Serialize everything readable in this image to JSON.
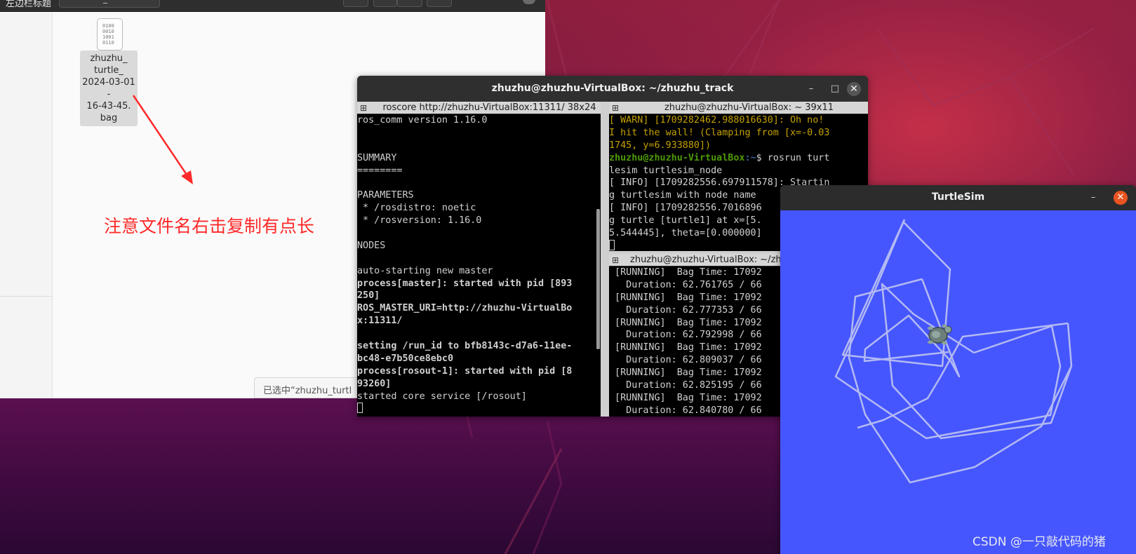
{
  "file_manager": {
    "title": "左边栏标题",
    "path_text": "_",
    "file": {
      "icon": "binary-file-icon",
      "icon_text": "0100\n0010\n1001\n0110",
      "name": "zhuzhu_\nturtle_\n2024-03-01-\n16-43-45.\nbag"
    },
    "annotation": "注意文件名右击复制有点长",
    "status_text": "已选中“zhuzhu_turtl"
  },
  "terminal": {
    "title": "zhuzhu@zhuzhu-VirtualBox: ~/zhuzhu_track",
    "minimize": "–",
    "maximize": "□",
    "close": "✕",
    "pane_icon": "⊞",
    "left_pane": {
      "header": "roscore http://zhuzhu-VirtualBox:11311/ 38x24",
      "lines": [
        "ros_comm version 1.16.0",
        "",
        "",
        "SUMMARY",
        "========",
        "",
        "PARAMETERS",
        " * /rosdistro: noetic",
        " * /rosversion: 1.16.0",
        "",
        "NODES",
        "",
        "auto-starting new master",
        "process[master]: started with pid [893",
        "250]",
        "ROS_MASTER_URI=http://zhuzhu-VirtualBo",
        "x:11311/",
        "",
        "setting /run_id to bfb8143c-d7a6-11ee-",
        "bc48-e7b50ce8ebc0",
        "process[rosout-1]: started with pid [8",
        "93260]",
        "started core service [/rosout]"
      ]
    },
    "top_right_pane": {
      "header": "zhuzhu@zhuzhu-VirtualBox: ~ 39x11",
      "warn_lines": [
        "[ WARN] [1709282462.988016630]: Oh no!",
        "I hit the wall! (Clamping from [x=-0.03",
        "1745, y=6.933880])"
      ],
      "prompt_user": "zhuzhu@zhuzhu-VirtualBox",
      "prompt_path": ":~",
      "prompt_cmd": "$ rosrun turt",
      "lines": [
        "lesim turtlesim_node",
        "[ INFO] [1709282556.697911578]: Startin",
        "g turtlesim with node name",
        "[ INFO] [1709282556.7016896",
        "g turtle [turtle1] at x=[5.",
        "5.544445], theta=[0.000000]"
      ]
    },
    "bottom_right_pane": {
      "header": "zhuzhu@zhuzhu-VirtualBox: ~/zh",
      "lines": [
        " [RUNNING]  Bag Time: 17092",
        "   Duration: 62.761765 / 66",
        " [RUNNING]  Bag Time: 17092",
        "   Duration: 62.777353 / 66",
        " [RUNNING]  Bag Time: 17092",
        "   Duration: 62.792998 / 66",
        " [RUNNING]  Bag Time: 17092",
        "   Duration: 62.809037 / 66",
        " [RUNNING]  Bag Time: 17092",
        "   Duration: 62.825195 / 66",
        " [RUNNING]  Bag Time: 17092",
        "   Duration: 62.840780 / 66"
      ]
    }
  },
  "turtlesim": {
    "title": "TurtleSim",
    "minimize": "–",
    "close": "✕",
    "background_color": "#4556ff",
    "trail_color": "#b3b9f2"
  },
  "watermark": "CSDN @一只敲代码的猪"
}
